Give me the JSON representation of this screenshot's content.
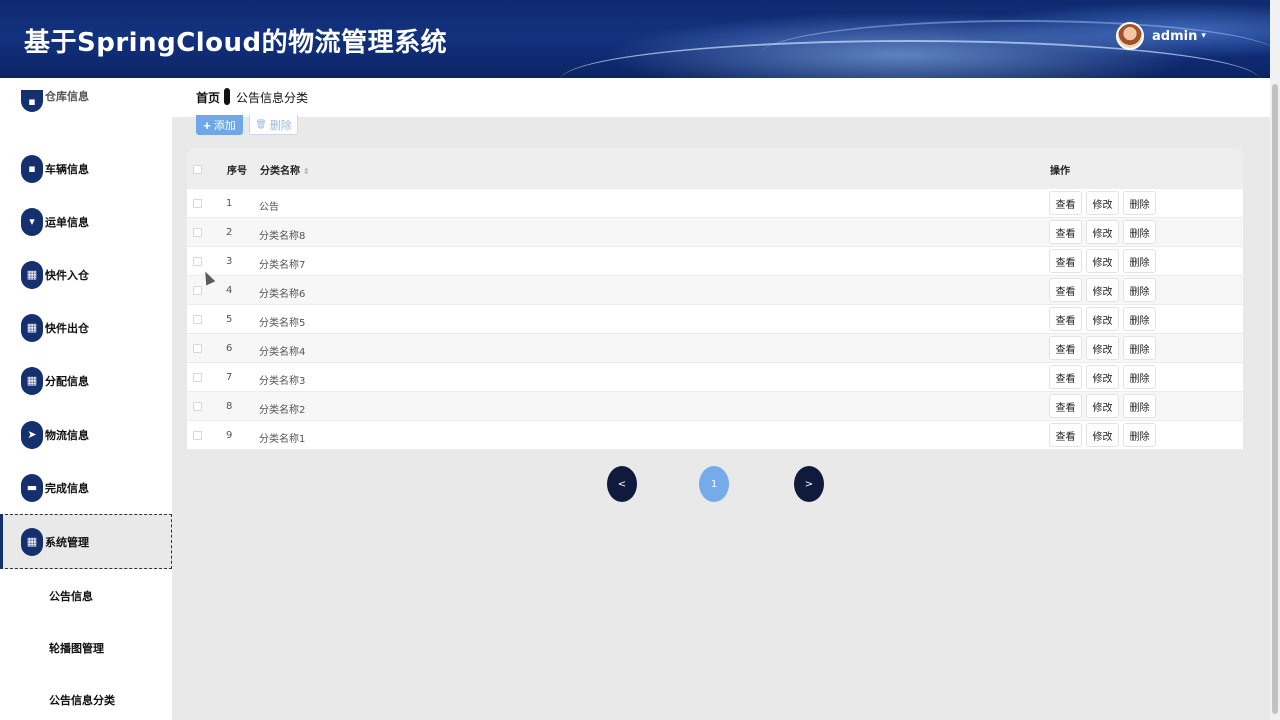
{
  "header": {
    "app_title": "基于SpringCloud的物流管理系统",
    "user_name": "admin",
    "caret": "▾"
  },
  "sidebar": {
    "items": [
      {
        "label": "仓库信息",
        "icon": "info-icon"
      },
      {
        "label": "车辆信息",
        "icon": "truck-icon"
      },
      {
        "label": "运单信息",
        "icon": "document-icon"
      },
      {
        "label": "快件入仓",
        "icon": "grid-icon"
      },
      {
        "label": "快件出仓",
        "icon": "grid-icon"
      },
      {
        "label": "分配信息",
        "icon": "grid-icon"
      },
      {
        "label": "物流信息",
        "icon": "send-icon"
      },
      {
        "label": "完成信息",
        "icon": "chat-icon"
      },
      {
        "label": "系统管理",
        "icon": "grid-icon"
      }
    ],
    "sub_items": [
      "公告信息",
      "轮播图管理",
      "公告信息分类"
    ]
  },
  "breadcrumb": {
    "home": "首页",
    "current": "公告信息分类"
  },
  "toolbar": {
    "add_label": "添加",
    "add_icon": "+",
    "delete_label": "删除",
    "delete_icon": "🗑"
  },
  "table": {
    "columns": {
      "index": "序号",
      "name": "分类名称",
      "sort_icon": "⇕",
      "ops": "操作"
    },
    "rows": [
      {
        "index": "1",
        "name": "公告"
      },
      {
        "index": "2",
        "name": "分类名称8"
      },
      {
        "index": "3",
        "name": "分类名称7"
      },
      {
        "index": "4",
        "name": "分类名称6"
      },
      {
        "index": "5",
        "name": "分类名称5"
      },
      {
        "index": "6",
        "name": "分类名称4"
      },
      {
        "index": "7",
        "name": "分类名称3"
      },
      {
        "index": "8",
        "name": "分类名称2"
      },
      {
        "index": "9",
        "name": "分类名称1"
      }
    ],
    "op_labels": {
      "view": "查看",
      "edit": "修改",
      "delete": "删除"
    }
  },
  "pagination": {
    "prev": "<",
    "current": "1",
    "next": ">"
  },
  "colors": {
    "brand": "#14306e",
    "accent": "#74abe8",
    "page_dark": "#101a3c"
  }
}
